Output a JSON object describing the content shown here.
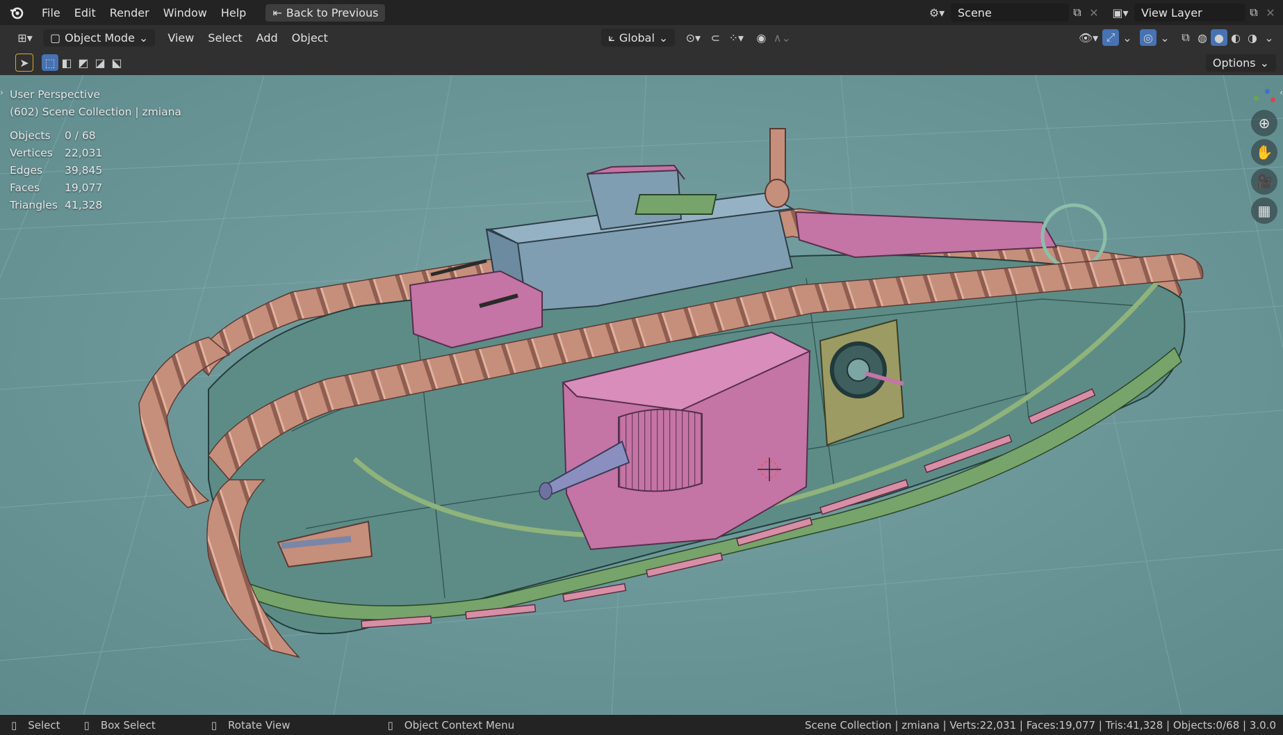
{
  "topbar": {
    "menu": [
      "File",
      "Edit",
      "Render",
      "Window",
      "Help"
    ],
    "back_button": "Back to Previous",
    "scene_label": "Scene",
    "view_layer_label": "View Layer"
  },
  "header": {
    "mode": "Object Mode",
    "menus": [
      "View",
      "Select",
      "Add",
      "Object"
    ],
    "transform_orientation": "Global",
    "options_label": "Options"
  },
  "viewport": {
    "perspective": "User Perspective",
    "collection": "(602) Scene Collection | zmiana",
    "stats": [
      {
        "key": "Objects",
        "value": "0 / 68"
      },
      {
        "key": "Vertices",
        "value": "22,031"
      },
      {
        "key": "Edges",
        "value": "39,845"
      },
      {
        "key": "Faces",
        "value": "19,077"
      },
      {
        "key": "Triangles",
        "value": "41,328"
      }
    ]
  },
  "statusbar": {
    "select": "Select",
    "box_select": "Box Select",
    "rotate_view": "Rotate View",
    "context_menu": "Object Context Menu",
    "summary": "Scene Collection | zmiana | Verts:22,031 | Faces:19,077 | Tris:41,328 | Objects:0/68 | 3.0.0"
  },
  "colors": {
    "viewport_bg": "#6b9596",
    "track": "#c38c78",
    "hull": "#5d8c87",
    "pink": "#c773a8",
    "blue": "#7f9eb2",
    "green": "#76a46a"
  }
}
